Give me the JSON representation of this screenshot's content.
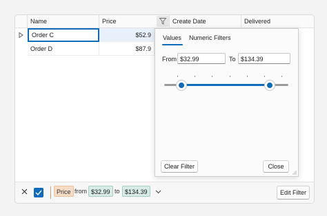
{
  "grid": {
    "columns": [
      "Name",
      "Price",
      "Create Date",
      "Delivered"
    ],
    "rows": [
      {
        "name": "Order C",
        "price": "$52.9"
      },
      {
        "name": "Order D",
        "price": "$87.9"
      }
    ]
  },
  "popup": {
    "tabs": [
      "Values",
      "Numeric Filters"
    ],
    "from_label": "From",
    "from_value": "$32.99",
    "to_label": "To",
    "to_value": "$134.39",
    "clear_label": "Clear Filter",
    "close_label": "Close"
  },
  "filter_panel": {
    "field": "Price",
    "from_word": "from",
    "from_value": "$32.99",
    "to_word": "to",
    "to_value": "$134.39",
    "edit_label": "Edit Filter",
    "enabled": true
  },
  "colors": {
    "accent": "#0f6cbd",
    "field_token": "#f5dcc6",
    "value_token": "#d8ebe7"
  },
  "icons": [
    "filter-icon",
    "row-indicator-icon",
    "close-icon",
    "checkmark-icon",
    "chevron-down-icon",
    "resize-grip-icon"
  ]
}
